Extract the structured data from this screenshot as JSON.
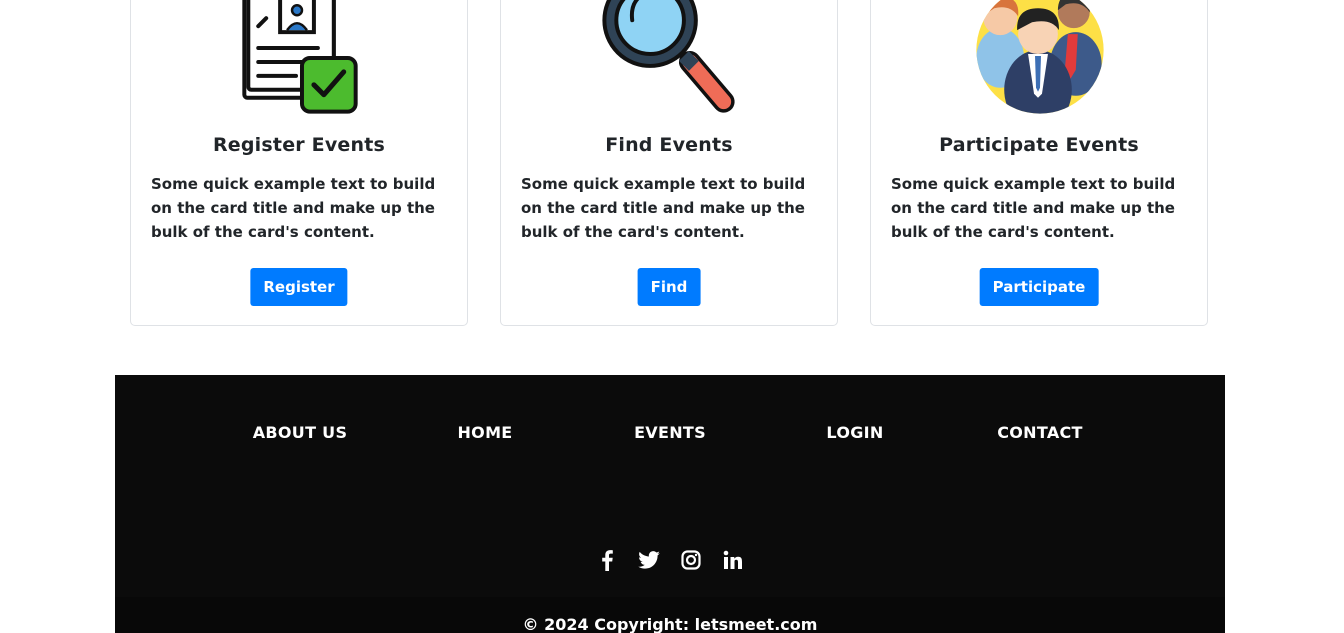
{
  "cards": [
    {
      "title": "Register Events",
      "text": "Some quick example text to build on the card title and make up the bulk of the card's content.",
      "button": "Register",
      "icon": "document-checkmark-icon"
    },
    {
      "title": "Find Events",
      "text": "Some quick example text to build on the card title and make up the bulk of the card's content.",
      "button": "Find",
      "icon": "magnifying-glass-icon"
    },
    {
      "title": "Participate Events",
      "text": "Some quick example text to build on the card title and make up the bulk of the card's content.",
      "button": "Participate",
      "icon": "people-group-icon"
    }
  ],
  "footer": {
    "nav": [
      "About Us",
      "Home",
      "Events",
      "Login",
      "Contact"
    ],
    "social": [
      "facebook-icon",
      "twitter-icon",
      "instagram-icon",
      "linkedin-icon"
    ],
    "copyright": "© 2024 Copyright: letsmeet.com"
  },
  "colors": {
    "primary": "#007bff",
    "footer_bg": "#0b0b0b",
    "text": "#212529",
    "border": "#dfe2e6"
  }
}
